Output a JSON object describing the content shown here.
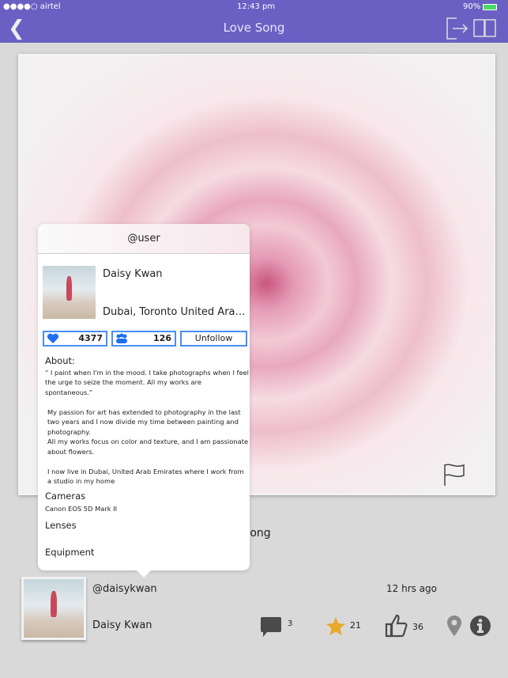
{
  "status": {
    "carrier": "●●●●○ airtel",
    "time": "12:43 pm",
    "battery": "90%"
  },
  "nav": {
    "title": "Love Song",
    "back_icon": "chevron-left-icon",
    "logout_icon": "logout-icon",
    "book_icon": "book-icon"
  },
  "post": {
    "title": "Love Song",
    "username": "@daisykwan",
    "name": "Daisy Kwan",
    "time": "12 hrs ago",
    "comments": "3",
    "stars": "21",
    "likes": "36"
  },
  "popover": {
    "header": "@user",
    "name": "Daisy Kwan",
    "location": "Dubai, Toronto United Arab Emirates",
    "likes": "4377",
    "followers": "126",
    "unfollow": "Unfollow",
    "about_heading": "About:",
    "about_p1": "“ I paint when I'm in the mood. I take photographs when I feel the urge to seize the moment. All my works are spontaneous.”",
    "about_p2": "My passion for art has extended to photography in the last two years and I now divide my time between painting and photography.",
    "about_p3": "All my works focus on color and texture, and I am passionate about flowers.",
    "about_p4": "I now live in Dubai, United Arab Emirates where I work from a studio in my home",
    "cameras_heading": "Cameras",
    "cameras": "Canon EOS 5D Mark II",
    "lenses_heading": "Lenses",
    "equipment_heading": "Equipment"
  },
  "colors": {
    "nav": "#6a60c4",
    "accent": "#4a8df5",
    "star": "#e8a92a"
  }
}
